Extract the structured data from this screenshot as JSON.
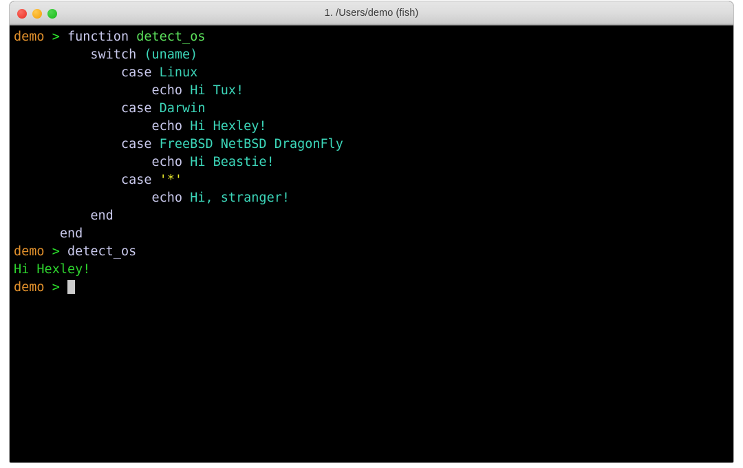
{
  "window": {
    "title": "1. /Users/demo (fish)",
    "traffic_lights": [
      {
        "name": "close",
        "color": "#ef4136"
      },
      {
        "name": "minimize",
        "color": "#f7ab1c"
      },
      {
        "name": "zoom",
        "color": "#29c329"
      }
    ]
  },
  "palette": {
    "background": "#000000",
    "prompt_user": "#e2912c",
    "prompt_arrow": "#2ce52c",
    "keyword": "#c9c9ec",
    "function_name": "#5ce25c",
    "parameter": "#3cd7ba",
    "quoted_string": "#e8e82c",
    "output": "#2ed42e",
    "cursor": "#cccccc",
    "titlebar": "#dedede"
  },
  "terminal": {
    "shell": "fish",
    "cwd": "/Users/demo",
    "cursor_glyph": "block",
    "lines": [
      {
        "id": "line-1",
        "tokens": [
          {
            "text": "demo",
            "cls": "c-prompt"
          },
          {
            "text": " > ",
            "cls": "c-arrow"
          },
          {
            "text": "function ",
            "cls": "c-keyword"
          },
          {
            "text": "detect_os",
            "cls": "c-funcname"
          }
        ]
      },
      {
        "id": "line-2",
        "tokens": [
          {
            "text": "          switch ",
            "cls": "c-keyword"
          },
          {
            "text": "(uname)",
            "cls": "c-param"
          }
        ]
      },
      {
        "id": "line-3",
        "tokens": [
          {
            "text": "              case ",
            "cls": "c-keyword"
          },
          {
            "text": "Linux",
            "cls": "c-param"
          }
        ]
      },
      {
        "id": "line-4",
        "tokens": [
          {
            "text": "                  echo ",
            "cls": "c-keyword"
          },
          {
            "text": "Hi Tux!",
            "cls": "c-param"
          }
        ]
      },
      {
        "id": "line-5",
        "tokens": [
          {
            "text": "              case ",
            "cls": "c-keyword"
          },
          {
            "text": "Darwin",
            "cls": "c-param"
          }
        ]
      },
      {
        "id": "line-6",
        "tokens": [
          {
            "text": "                  echo ",
            "cls": "c-keyword"
          },
          {
            "text": "Hi Hexley!",
            "cls": "c-param"
          }
        ]
      },
      {
        "id": "line-7",
        "tokens": [
          {
            "text": "              case ",
            "cls": "c-keyword"
          },
          {
            "text": "FreeBSD NetBSD DragonFly",
            "cls": "c-param"
          }
        ]
      },
      {
        "id": "line-8",
        "tokens": [
          {
            "text": "                  echo ",
            "cls": "c-keyword"
          },
          {
            "text": "Hi Beastie!",
            "cls": "c-param"
          }
        ]
      },
      {
        "id": "line-9",
        "tokens": [
          {
            "text": "              case ",
            "cls": "c-keyword"
          },
          {
            "text": "'*'",
            "cls": "c-quoted"
          }
        ]
      },
      {
        "id": "line-10",
        "tokens": [
          {
            "text": "                  echo ",
            "cls": "c-keyword"
          },
          {
            "text": "Hi, stranger!",
            "cls": "c-param"
          }
        ]
      },
      {
        "id": "line-11",
        "tokens": [
          {
            "text": "          end",
            "cls": "c-keyword"
          }
        ]
      },
      {
        "id": "line-12",
        "tokens": [
          {
            "text": "      end",
            "cls": "c-keyword"
          }
        ]
      },
      {
        "id": "line-13",
        "tokens": [
          {
            "text": "demo",
            "cls": "c-prompt"
          },
          {
            "text": " > ",
            "cls": "c-arrow"
          },
          {
            "text": "detect_os",
            "cls": "c-plain"
          }
        ]
      },
      {
        "id": "line-14",
        "tokens": [
          {
            "text": "Hi Hexley!",
            "cls": "c-output"
          }
        ]
      },
      {
        "id": "line-15",
        "tokens": [
          {
            "text": "demo",
            "cls": "c-prompt"
          },
          {
            "text": " > ",
            "cls": "c-arrow"
          }
        ],
        "cursor": true
      }
    ]
  }
}
